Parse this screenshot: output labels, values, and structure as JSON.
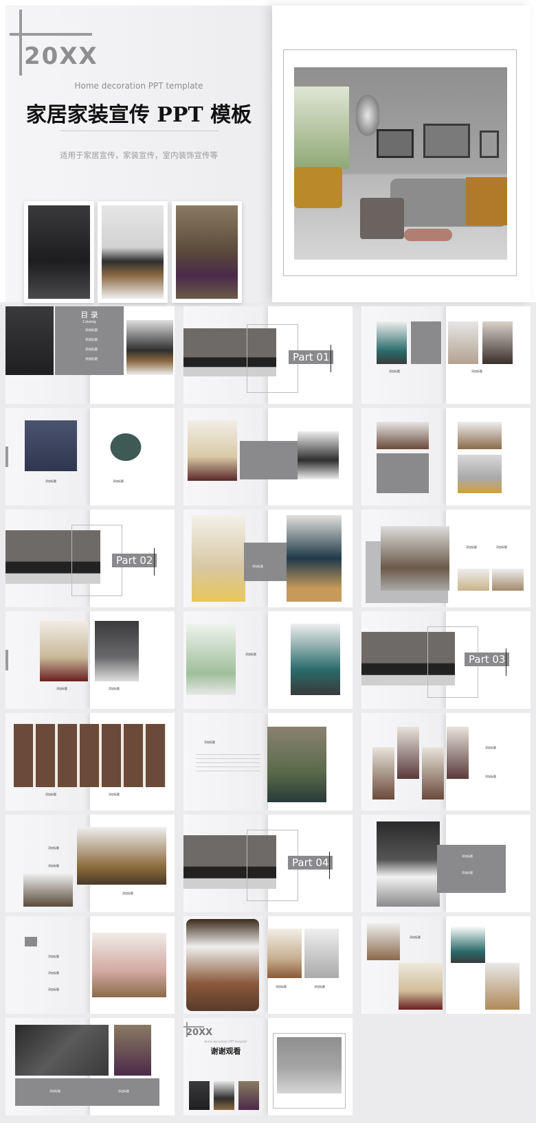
{
  "cover": {
    "year": "20XX",
    "subtitle_en": "Home decoration PPT template",
    "title": "家居家装宣传 PPT 模板",
    "subtitle_cn": "适用于家居宣传，家装宣传，室内装饰宣传等"
  },
  "toc": {
    "title": "目 录",
    "subtitle": "Catalog",
    "items": [
      "添加标题",
      "添加标题",
      "添加标题",
      "添加标题"
    ]
  },
  "parts": [
    "Part 01",
    "Part 02",
    "Part 03",
    "Part 04"
  ],
  "label": "添加标题",
  "closing": {
    "year": "20XX",
    "title": "谢谢观看",
    "subtitle_en": "Home decoration PPT template"
  },
  "colors": {
    "accent_grey": "#8a8a8c",
    "background": "#ebebed"
  }
}
